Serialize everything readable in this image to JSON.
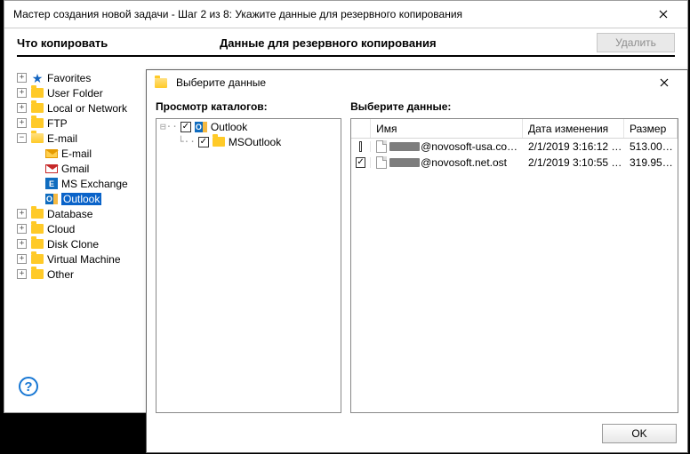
{
  "win1": {
    "title": "Мастер создания новой задачи - Шаг 2 из 8: Укажите данные для резервного копирования",
    "header_left": "Что копировать",
    "header_mid": "Данные для резервного копирования",
    "delete_btn": "Удалить",
    "help_glyph": "?"
  },
  "tree": [
    {
      "exp": "+",
      "indent": 0,
      "icon": "star",
      "label": "Favorites"
    },
    {
      "exp": "+",
      "indent": 0,
      "icon": "folder",
      "label": "User Folder"
    },
    {
      "exp": "+",
      "indent": 0,
      "icon": "folder",
      "label": "Local or Network"
    },
    {
      "exp": "+",
      "indent": 0,
      "icon": "folder",
      "label": "FTP"
    },
    {
      "exp": "−",
      "indent": 0,
      "icon": "folder-open",
      "label": "E-mail"
    },
    {
      "exp": "",
      "indent": 1,
      "icon": "mail",
      "label": "E-mail"
    },
    {
      "exp": "",
      "indent": 1,
      "icon": "gmail",
      "label": "Gmail"
    },
    {
      "exp": "",
      "indent": 1,
      "icon": "exchange",
      "label": "MS Exchange"
    },
    {
      "exp": "",
      "indent": 1,
      "icon": "outlook",
      "label": "Outlook",
      "selected": true
    },
    {
      "exp": "+",
      "indent": 0,
      "icon": "folder",
      "label": "Database"
    },
    {
      "exp": "+",
      "indent": 0,
      "icon": "folder",
      "label": "Cloud"
    },
    {
      "exp": "+",
      "indent": 0,
      "icon": "folder",
      "label": "Disk Clone"
    },
    {
      "exp": "+",
      "indent": 0,
      "icon": "folder",
      "label": "Virtual Machine"
    },
    {
      "exp": "+",
      "indent": 0,
      "icon": "folder",
      "label": "Other"
    }
  ],
  "win2": {
    "title": "Выберите данные",
    "left_title": "Просмотр каталогов:",
    "right_title": "Выберите данные:",
    "ok_btn": "OK"
  },
  "catalog": {
    "root_label": "Outlook",
    "child_label": "MSOutlook"
  },
  "list": {
    "columns": {
      "name": "Имя",
      "date": "Дата изменения",
      "size": "Размер"
    },
    "rows": [
      {
        "checked": false,
        "suffix": "@novosoft-usa.co…",
        "date": "2/1/2019 3:16:12 …",
        "size": "513.00…"
      },
      {
        "checked": true,
        "suffix": "@novosoft.net.ost",
        "date": "2/1/2019 3:10:55 …",
        "size": "319.95…"
      }
    ]
  }
}
